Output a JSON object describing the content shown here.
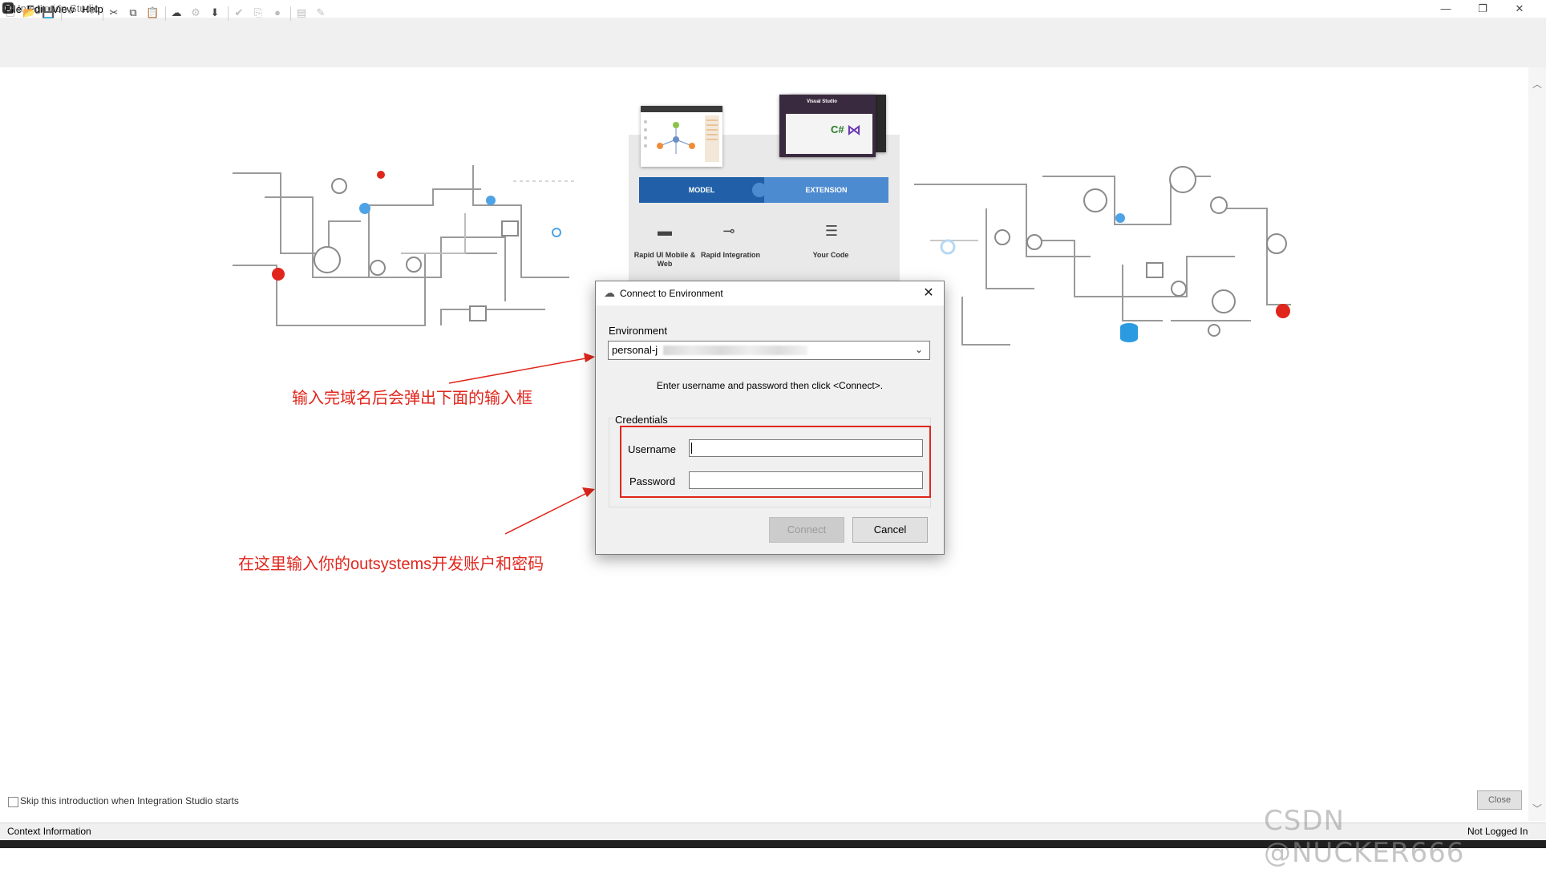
{
  "window": {
    "title": "Integration Studio",
    "minimize": "—",
    "restore": "❐",
    "close": "✕"
  },
  "menu": [
    "File",
    "Edit",
    "View",
    "Help"
  ],
  "intro": {
    "model_label": "MODEL",
    "extension_label": "EXTENSION",
    "features": [
      {
        "label": "Rapid UI Mobile & Web"
      },
      {
        "label": "Rapid Integration"
      },
      {
        "label": "Your Code"
      }
    ],
    "vs_title": "Visual Studio",
    "csharp": "C#"
  },
  "dialog": {
    "title": "Connect to Environment",
    "environment_label": "Environment",
    "environment_value": "personal-j",
    "hint": "Enter username and password then click <Connect>.",
    "credentials_label": "Credentials",
    "username_label": "Username",
    "username_value": "",
    "password_label": "Password",
    "password_value": "",
    "connect_label": "Connect",
    "cancel_label": "Cancel",
    "close_glyph": "✕"
  },
  "annotations": {
    "top": "输入完域名后会弹出下面的输入框",
    "bottom": "在这里输入你的outsystems开发账户和密码",
    "color": "#e0261c"
  },
  "footer": {
    "skip_label": "Skip this introduction when Integration Studio starts",
    "skip_checked": false,
    "close_label": "Close"
  },
  "status": {
    "left": "Context Information",
    "right": "Not Logged In"
  },
  "watermark": "CSDN @NUCKER666",
  "colors": {
    "model": "#2160a8",
    "extension": "#4d8bd0",
    "accent_red": "#e0261c"
  }
}
